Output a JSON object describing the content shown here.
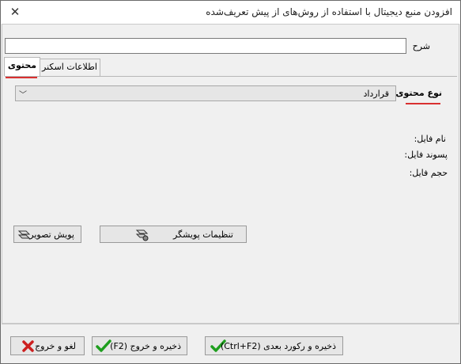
{
  "window": {
    "title": "افزودن منبع دیجیتال با استفاده از روش‌های از پیش تعریف‌شده",
    "close": "✕"
  },
  "form": {
    "description_label": "شرح",
    "description_value": ""
  },
  "tabs": [
    {
      "label": "محتوی",
      "active": true
    },
    {
      "label": "اطلاعات اسکنر",
      "active": false
    }
  ],
  "content": {
    "type_label": "نوع محتوی",
    "type_value": "قرارداد",
    "file_name_label": "نام فایل:",
    "file_ext_label": "پسوند فایل:",
    "file_size_label": "حجم فایل:"
  },
  "scanner": {
    "settings_label": "تنظیمات پویشگر",
    "scan_label": "پویش تصویر"
  },
  "footer": {
    "save_next_label": "ذخیره و رکورد بعدی (Ctrl+F2)",
    "save_exit_label": "ذخیره و خروج (F2)",
    "cancel_label": "لغو و خروج"
  },
  "colors": {
    "accent_red": "#d93030",
    "check_green": "#1e9e1e",
    "cancel_red": "#cc1f1f"
  }
}
